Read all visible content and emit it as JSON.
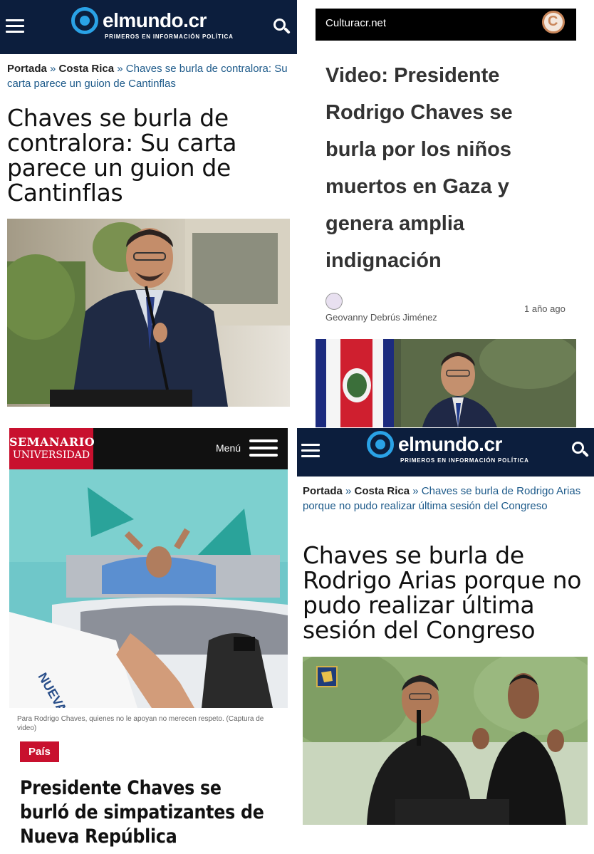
{
  "panel_top_left": {
    "header": {
      "brand": "elmundo.cr",
      "tagline": "PRIMEROS EN INFORMACIÓN POLÍTICA",
      "menu_icon": "hamburger-menu-icon",
      "search_icon": "search-icon",
      "bg_color": "#0c1e3d",
      "accent_color": "#2aa2e6"
    },
    "breadcrumb": {
      "home": "Portada",
      "separator": "»",
      "section": "Costa Rica",
      "current": "Chaves se burla de contralora: Su carta parece un guion de Cantinflas"
    },
    "title": "Chaves se burla de contralora: Su carta parece un guion de Cantinflas"
  },
  "panel_top_right": {
    "site_name": "Culturacr.net",
    "logo_icon": "culturacr-logo-icon",
    "title": "Video: Presidente Rodrigo Chaves se burla por los niños muertos en Gaza y genera amplia indignación",
    "author": "Geovanny Debrús Jiménez",
    "time_ago": "1 año ago"
  },
  "panel_bottom_left": {
    "logo_line1": "SEMANARIO",
    "logo_line2": "UNIVERSIDAD",
    "menu_label": "Menú",
    "caption": "Para Rodrigo Chaves, quienes no le apoyan no merecen respeto. (Captura de video)",
    "section": "País",
    "title": "Presidente Chaves se burló de simpatizantes de Nueva República",
    "brand_color": "#c8102e"
  },
  "panel_bottom_right": {
    "header": {
      "brand": "elmundo.cr",
      "tagline": "PRIMEROS EN INFORMACIÓN POLÍTICA"
    },
    "breadcrumb": {
      "home": "Portada",
      "separator": "»",
      "section": "Costa Rica",
      "current": "Chaves se burla de Rodrigo Arias porque no pudo realizar última sesión del Congreso"
    },
    "title": "Chaves se burla de Rodrigo Arias porque no pudo realizar última sesión del Congreso"
  }
}
